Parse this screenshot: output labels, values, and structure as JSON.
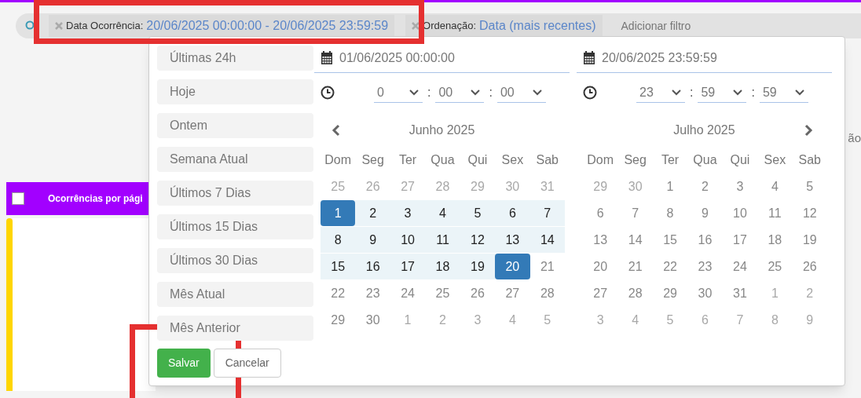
{
  "filter_bar": {
    "chips": [
      {
        "label": "Data Ocorrência:",
        "value": "20/06/2025 00:00:00 - 20/06/2025 23:59:59"
      },
      {
        "label": "Ordenação:",
        "value": "Data (mais recentes)"
      }
    ],
    "add_filter": "Adicionar filtro"
  },
  "background": {
    "table_header": "Ocorrências por pági",
    "fragment": "ão",
    "select_all_checked": false
  },
  "date_picker": {
    "presets": [
      "Últimas 24h",
      "Hoje",
      "Ontem",
      "Semana Atual",
      "Últimos 7 Dias",
      "Últimos 15 Dias",
      "Últimos 30 Dias",
      "Mês Atual",
      "Mês Anterior"
    ],
    "panels": [
      {
        "date": "01/06/2025 00:00:00",
        "time": [
          "0",
          "00",
          "00"
        ],
        "separator": ":",
        "month": "Junho 2025",
        "prev_arrow": true,
        "next_arrow": false,
        "weekdays": [
          "Dom",
          "Seg",
          "Ter",
          "Qua",
          "Qui",
          "Sex",
          "Sab"
        ],
        "weeks": [
          [
            {
              "day": "25",
              "off": true,
              "selected": false,
              "in_range": false
            },
            {
              "day": "26",
              "off": true,
              "selected": false,
              "in_range": false
            },
            {
              "day": "27",
              "off": true,
              "selected": false,
              "in_range": false
            },
            {
              "day": "28",
              "off": true,
              "selected": false,
              "in_range": false
            },
            {
              "day": "29",
              "off": true,
              "selected": false,
              "in_range": false
            },
            {
              "day": "30",
              "off": true,
              "selected": false,
              "in_range": false
            },
            {
              "day": "31",
              "off": true,
              "selected": false,
              "in_range": false
            }
          ],
          [
            {
              "day": "1",
              "off": false,
              "selected": true,
              "in_range": true
            },
            {
              "day": "2",
              "off": false,
              "selected": false,
              "in_range": true
            },
            {
              "day": "3",
              "off": false,
              "selected": false,
              "in_range": true
            },
            {
              "day": "4",
              "off": false,
              "selected": false,
              "in_range": true
            },
            {
              "day": "5",
              "off": false,
              "selected": false,
              "in_range": true
            },
            {
              "day": "6",
              "off": false,
              "selected": false,
              "in_range": true
            },
            {
              "day": "7",
              "off": false,
              "selected": false,
              "in_range": true
            }
          ],
          [
            {
              "day": "8",
              "off": false,
              "selected": false,
              "in_range": true
            },
            {
              "day": "9",
              "off": false,
              "selected": false,
              "in_range": true
            },
            {
              "day": "10",
              "off": false,
              "selected": false,
              "in_range": true
            },
            {
              "day": "11",
              "off": false,
              "selected": false,
              "in_range": true
            },
            {
              "day": "12",
              "off": false,
              "selected": false,
              "in_range": true
            },
            {
              "day": "13",
              "off": false,
              "selected": false,
              "in_range": true
            },
            {
              "day": "14",
              "off": false,
              "selected": false,
              "in_range": true
            }
          ],
          [
            {
              "day": "15",
              "off": false,
              "selected": false,
              "in_range": true
            },
            {
              "day": "16",
              "off": false,
              "selected": false,
              "in_range": true
            },
            {
              "day": "17",
              "off": false,
              "selected": false,
              "in_range": true
            },
            {
              "day": "18",
              "off": false,
              "selected": false,
              "in_range": true
            },
            {
              "day": "19",
              "off": false,
              "selected": false,
              "in_range": true
            },
            {
              "day": "20",
              "off": false,
              "selected": true,
              "in_range": true
            },
            {
              "day": "21",
              "off": false,
              "selected": false,
              "in_range": false
            }
          ],
          [
            {
              "day": "22",
              "off": false,
              "selected": false,
              "in_range": false
            },
            {
              "day": "23",
              "off": false,
              "selected": false,
              "in_range": false
            },
            {
              "day": "24",
              "off": false,
              "selected": false,
              "in_range": false
            },
            {
              "day": "25",
              "off": false,
              "selected": false,
              "in_range": false
            },
            {
              "day": "26",
              "off": false,
              "selected": false,
              "in_range": false
            },
            {
              "day": "27",
              "off": false,
              "selected": false,
              "in_range": false
            },
            {
              "day": "28",
              "off": false,
              "selected": false,
              "in_range": false
            }
          ],
          [
            {
              "day": "29",
              "off": false,
              "selected": false,
              "in_range": false
            },
            {
              "day": "30",
              "off": false,
              "selected": false,
              "in_range": false
            },
            {
              "day": "1",
              "off": true,
              "selected": false,
              "in_range": false
            },
            {
              "day": "2",
              "off": true,
              "selected": false,
              "in_range": false
            },
            {
              "day": "3",
              "off": true,
              "selected": false,
              "in_range": false
            },
            {
              "day": "4",
              "off": true,
              "selected": false,
              "in_range": false
            },
            {
              "day": "5",
              "off": true,
              "selected": false,
              "in_range": false
            }
          ]
        ]
      },
      {
        "date": "20/06/2025 23:59:59",
        "time": [
          "23",
          "59",
          "59"
        ],
        "separator": ":",
        "month": "Julho 2025",
        "prev_arrow": false,
        "next_arrow": true,
        "weekdays": [
          "Dom",
          "Seg",
          "Ter",
          "Qua",
          "Qui",
          "Sex",
          "Sab"
        ],
        "weeks": [
          [
            {
              "day": "29",
              "off": true,
              "selected": false,
              "in_range": false
            },
            {
              "day": "30",
              "off": true,
              "selected": false,
              "in_range": false
            },
            {
              "day": "1",
              "off": false,
              "selected": false,
              "in_range": false
            },
            {
              "day": "2",
              "off": false,
              "selected": false,
              "in_range": false
            },
            {
              "day": "3",
              "off": false,
              "selected": false,
              "in_range": false
            },
            {
              "day": "4",
              "off": false,
              "selected": false,
              "in_range": false
            },
            {
              "day": "5",
              "off": false,
              "selected": false,
              "in_range": false
            }
          ],
          [
            {
              "day": "6",
              "off": false,
              "selected": false,
              "in_range": false
            },
            {
              "day": "7",
              "off": false,
              "selected": false,
              "in_range": false
            },
            {
              "day": "8",
              "off": false,
              "selected": false,
              "in_range": false
            },
            {
              "day": "9",
              "off": false,
              "selected": false,
              "in_range": false
            },
            {
              "day": "10",
              "off": false,
              "selected": false,
              "in_range": false
            },
            {
              "day": "11",
              "off": false,
              "selected": false,
              "in_range": false
            },
            {
              "day": "12",
              "off": false,
              "selected": false,
              "in_range": false
            }
          ],
          [
            {
              "day": "13",
              "off": false,
              "selected": false,
              "in_range": false
            },
            {
              "day": "14",
              "off": false,
              "selected": false,
              "in_range": false
            },
            {
              "day": "15",
              "off": false,
              "selected": false,
              "in_range": false
            },
            {
              "day": "16",
              "off": false,
              "selected": false,
              "in_range": false
            },
            {
              "day": "17",
              "off": false,
              "selected": false,
              "in_range": false
            },
            {
              "day": "18",
              "off": false,
              "selected": false,
              "in_range": false
            },
            {
              "day": "19",
              "off": false,
              "selected": false,
              "in_range": false
            }
          ],
          [
            {
              "day": "20",
              "off": false,
              "selected": false,
              "in_range": false
            },
            {
              "day": "21",
              "off": false,
              "selected": false,
              "in_range": false
            },
            {
              "day": "22",
              "off": false,
              "selected": false,
              "in_range": false
            },
            {
              "day": "23",
              "off": false,
              "selected": false,
              "in_range": false
            },
            {
              "day": "24",
              "off": false,
              "selected": false,
              "in_range": false
            },
            {
              "day": "25",
              "off": false,
              "selected": false,
              "in_range": false
            },
            {
              "day": "26",
              "off": false,
              "selected": false,
              "in_range": false
            }
          ],
          [
            {
              "day": "27",
              "off": false,
              "selected": false,
              "in_range": false
            },
            {
              "day": "28",
              "off": false,
              "selected": false,
              "in_range": false
            },
            {
              "day": "29",
              "off": false,
              "selected": false,
              "in_range": false
            },
            {
              "day": "30",
              "off": false,
              "selected": false,
              "in_range": false
            },
            {
              "day": "31",
              "off": false,
              "selected": false,
              "in_range": false
            },
            {
              "day": "1",
              "off": true,
              "selected": false,
              "in_range": false
            },
            {
              "day": "2",
              "off": true,
              "selected": false,
              "in_range": false
            }
          ],
          [
            {
              "day": "3",
              "off": true,
              "selected": false,
              "in_range": false
            },
            {
              "day": "4",
              "off": true,
              "selected": false,
              "in_range": false
            },
            {
              "day": "5",
              "off": true,
              "selected": false,
              "in_range": false
            },
            {
              "day": "6",
              "off": true,
              "selected": false,
              "in_range": false
            },
            {
              "day": "7",
              "off": true,
              "selected": false,
              "in_range": false
            },
            {
              "day": "8",
              "off": true,
              "selected": false,
              "in_range": false
            },
            {
              "day": "9",
              "off": true,
              "selected": false,
              "in_range": false
            }
          ]
        ]
      }
    ],
    "buttons": [
      {
        "label": "Salvar",
        "kind": "primary"
      },
      {
        "label": "Cancelar",
        "kind": "secondary"
      }
    ]
  }
}
